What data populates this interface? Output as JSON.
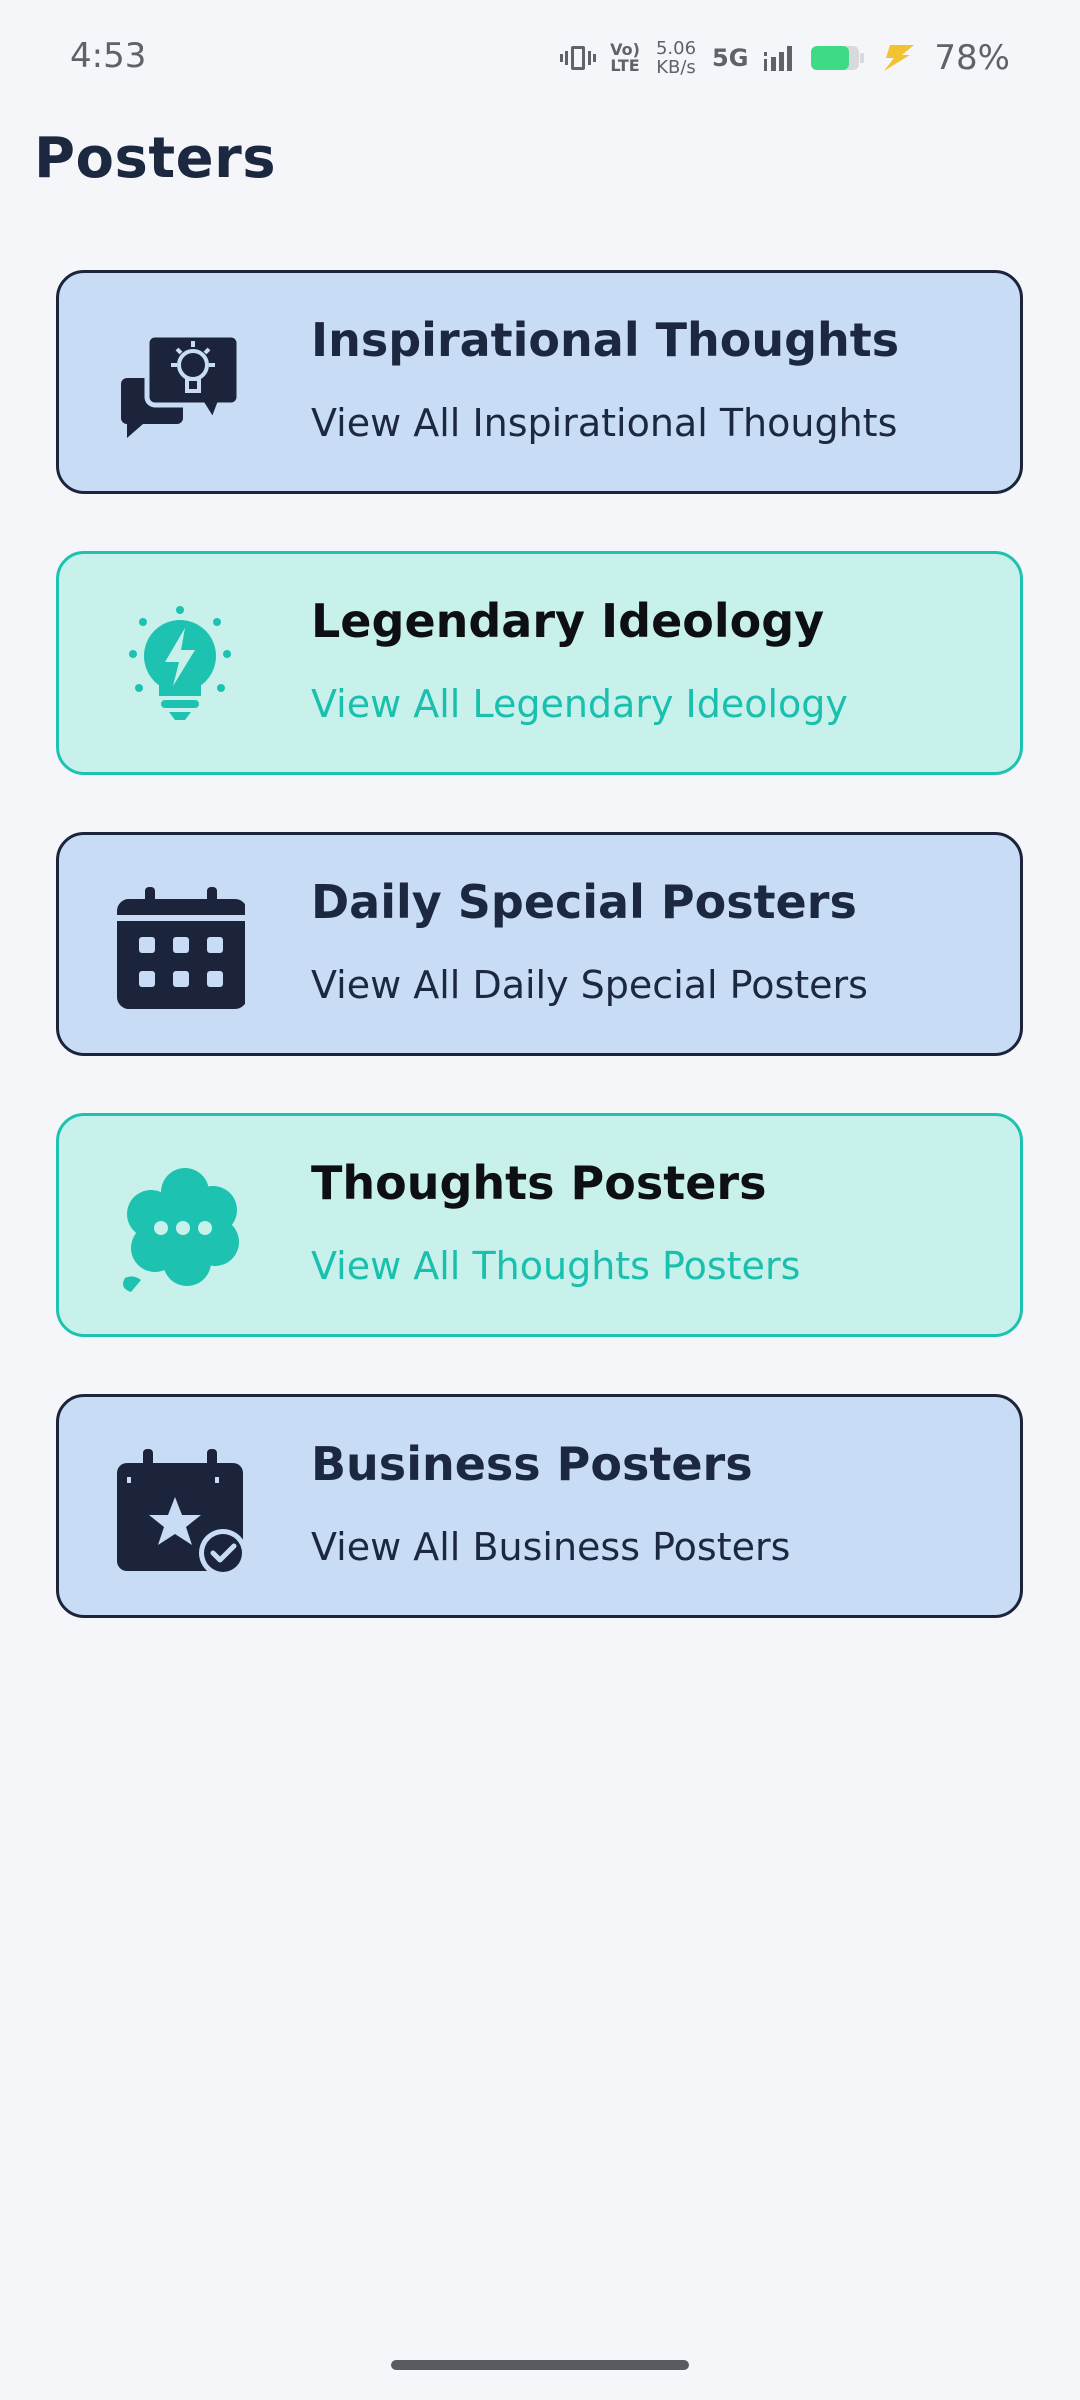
{
  "status_bar": {
    "time": "4:53",
    "volte_line1": "Vo)",
    "volte_line2": "LTE",
    "net_speed_value": "5.06",
    "net_speed_unit": "KB/s",
    "network": "5G",
    "battery_percent": "78%",
    "icons": [
      "vibrate-icon",
      "volte-icon",
      "signal-icon",
      "battery-icon",
      "charging-bolt-icon"
    ]
  },
  "header": {
    "title": "Posters"
  },
  "cards": [
    {
      "title": "Inspirational Thoughts",
      "subtitle": "View All Inspirational Thoughts",
      "icon": "lightbulb-chat-icon",
      "style": "blue"
    },
    {
      "title": "Legendary Ideology",
      "subtitle": "View All Legendary Ideology",
      "icon": "lightbulb-bolt-icon",
      "style": "teal"
    },
    {
      "title": "Daily Special Posters",
      "subtitle": "View All Daily Special Posters",
      "icon": "calendar-icon",
      "style": "blue"
    },
    {
      "title": "Thoughts Posters",
      "subtitle": "View All Thoughts Posters",
      "icon": "thought-bubble-icon",
      "style": "teal"
    },
    {
      "title": "Business Posters",
      "subtitle": "View All Business Posters",
      "icon": "calendar-star-check-icon",
      "style": "blue"
    }
  ],
  "colors": {
    "background": "#f4f6fa",
    "card_blue": "#c8dcf6",
    "card_teal": "#c9f1ec",
    "navy": "#1c2740",
    "teal_accent": "#18c0ad",
    "battery_green": "#3ddc84",
    "bolt_yellow": "#f2c230"
  }
}
